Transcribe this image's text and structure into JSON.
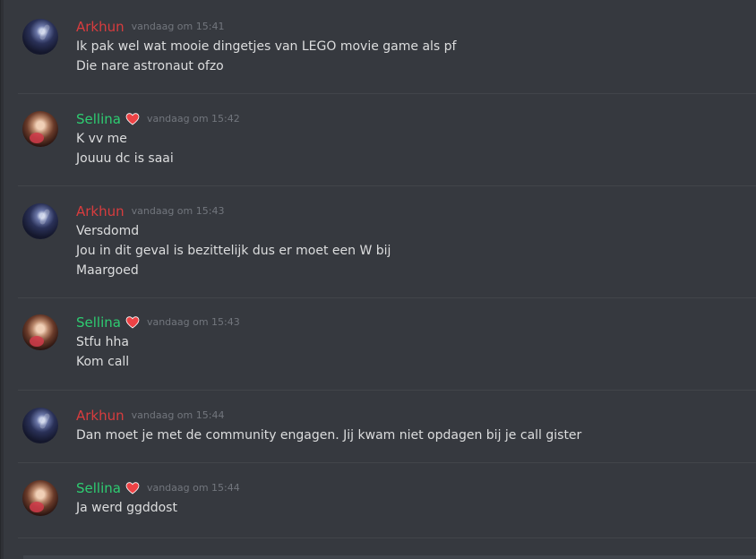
{
  "chat": {
    "messages": [
      {
        "username": "Arkhun",
        "user_color": "#d83c3e",
        "avatar": "arkhun-avatar",
        "has_heart": false,
        "timestamp": "vandaag om 15:41",
        "lines": [
          "Ik pak wel wat mooie dingetjes van LEGO movie game als pf",
          "Die nare astronaut ofzo"
        ]
      },
      {
        "username": "Sellina",
        "user_color": "#2ecc71",
        "avatar": "sellina-avatar",
        "has_heart": true,
        "timestamp": "vandaag om 15:42",
        "lines": [
          "K vv me",
          "Jouuu dc is saai"
        ]
      },
      {
        "username": "Arkhun",
        "user_color": "#d83c3e",
        "avatar": "arkhun-avatar",
        "has_heart": false,
        "timestamp": "vandaag om 15:43",
        "lines": [
          "Versdomd",
          "Jou in dit geval is bezittelijk dus er moet een W bij",
          "Maargoed"
        ]
      },
      {
        "username": "Sellina",
        "user_color": "#2ecc71",
        "avatar": "sellina-avatar",
        "has_heart": true,
        "timestamp": "vandaag om 15:43",
        "lines": [
          "Stfu hha",
          "Kom call"
        ]
      },
      {
        "username": "Arkhun",
        "user_color": "#d83c3e",
        "avatar": "arkhun-avatar",
        "has_heart": false,
        "timestamp": "vandaag om 15:44",
        "lines": [
          "Dan moet je met de community engagen. Jij kwam niet opdagen bij je call gister"
        ]
      },
      {
        "username": "Sellina",
        "user_color": "#2ecc71",
        "avatar": "sellina-avatar",
        "has_heart": true,
        "timestamp": "vandaag om 15:44",
        "lines": [
          "Ja werd ggddost"
        ]
      }
    ]
  },
  "colors": {
    "background": "#36393f",
    "message_text": "#dcddde",
    "timestamp": "#72767d",
    "divider": "#42454a",
    "heart": "#ed4245"
  },
  "icons": {
    "heart": "heart-icon"
  }
}
